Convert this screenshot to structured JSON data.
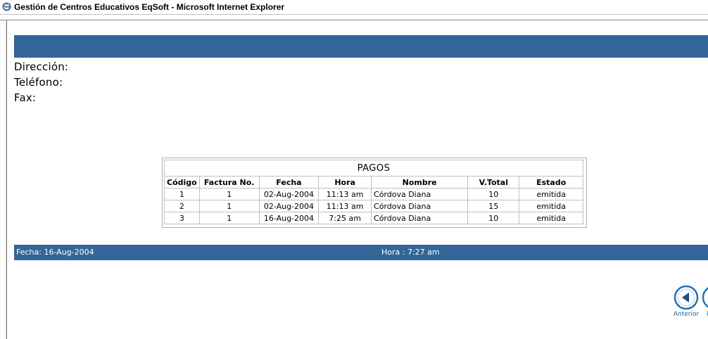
{
  "window": {
    "title": "Gestión de Centros Educativos EqSoft - Microsoft Internet Explorer",
    "icon": "ie-icon"
  },
  "header": {
    "direccion_label": "Dirección:",
    "telefono_label": "Teléfono:",
    "fax_label": "Fax:",
    "band_color": "#336699"
  },
  "table": {
    "title": "PAGOS",
    "columns": [
      "Código",
      "Factura No.",
      "Fecha",
      "Hora",
      "Nombre",
      "V.Total",
      "Estado"
    ],
    "rows": [
      [
        "1",
        "1",
        "02-Aug-2004",
        "11:13 am",
        "Córdova Diana",
        "10",
        "emitida"
      ],
      [
        "2",
        "1",
        "02-Aug-2004",
        "11:13 am",
        "Córdova Diana",
        "15",
        "emitida"
      ],
      [
        "3",
        "1",
        "16-Aug-2004",
        "7:25 am",
        "Córdova Diana",
        "10",
        "emitida"
      ]
    ]
  },
  "footer": {
    "fecha": "Fecha: 16-Aug-2004",
    "hora": "Hora : 7:27 am"
  },
  "nav": {
    "anterior_label": "Anterior",
    "next_label_partial": "I"
  }
}
